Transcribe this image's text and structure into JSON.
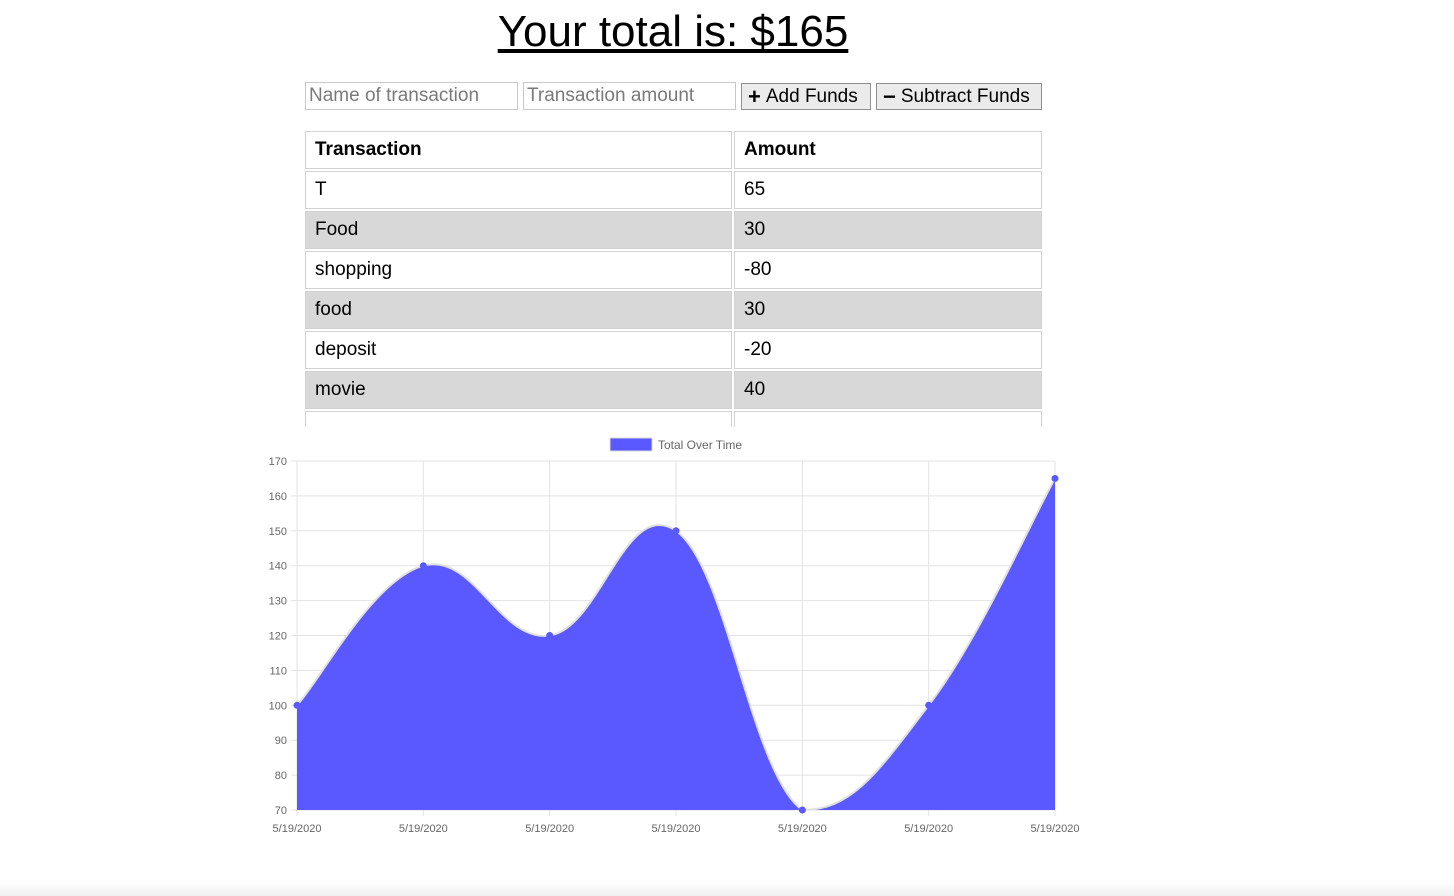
{
  "header": {
    "total_text": "Your total is: $165"
  },
  "form": {
    "name_placeholder": "Name of transaction",
    "amount_placeholder": "Transaction amount",
    "add_label": "Add Funds",
    "add_icon": "plus-icon",
    "subtract_label": "Subtract Funds",
    "subtract_icon": "minus-icon"
  },
  "table": {
    "headers": [
      "Transaction",
      "Amount"
    ],
    "rows": [
      {
        "name": "T",
        "amount": "65"
      },
      {
        "name": "Food",
        "amount": "30"
      },
      {
        "name": "shopping",
        "amount": "-80"
      },
      {
        "name": "food",
        "amount": "30"
      },
      {
        "name": "deposit",
        "amount": "-20"
      },
      {
        "name": "movie",
        "amount": "40"
      },
      {
        "name": "",
        "amount": ""
      }
    ]
  },
  "chart_data": {
    "type": "area",
    "legend": "Total Over Time",
    "legend_position": "top",
    "x": [
      "5/19/2020",
      "5/19/2020",
      "5/19/2020",
      "5/19/2020",
      "5/19/2020",
      "5/19/2020",
      "5/19/2020"
    ],
    "series": [
      {
        "name": "Total Over Time",
        "values": [
          100,
          140,
          120,
          150,
          70,
          100,
          165
        ]
      }
    ],
    "ylim": [
      70,
      170
    ],
    "yticks": [
      70,
      80,
      90,
      100,
      110,
      120,
      130,
      140,
      150,
      160,
      170
    ],
    "grid": true,
    "fill_color": "#5959ff",
    "line_color": "#e0e0e0"
  }
}
